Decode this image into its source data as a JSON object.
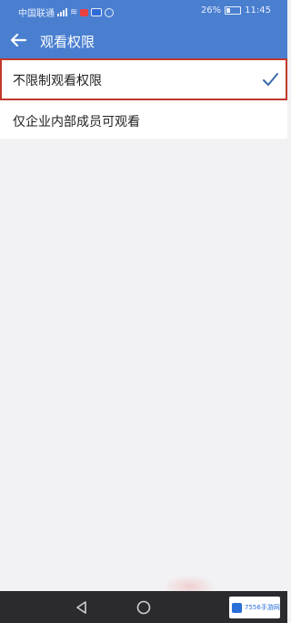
{
  "status_bar": {
    "carrier": "中国联通",
    "battery_percent": "26%",
    "time": "11:45"
  },
  "app_bar": {
    "title": "观看权限",
    "back_icon": "arrow-left-icon"
  },
  "options": [
    {
      "label": "不限制观看权限",
      "selected": true
    },
    {
      "label": "仅企业内部成员可观看",
      "selected": false
    }
  ],
  "nav_bar": {
    "back_icon": "triangle-back-icon",
    "home_icon": "circle-home-icon"
  },
  "watermark": {
    "text": "7556手游网"
  },
  "colors": {
    "accent": "#4a7fd0",
    "check": "#3a6aa8",
    "highlight_border": "#c0392b",
    "background": "#f2f2f4",
    "nav_bar": "#2b2b2f"
  }
}
